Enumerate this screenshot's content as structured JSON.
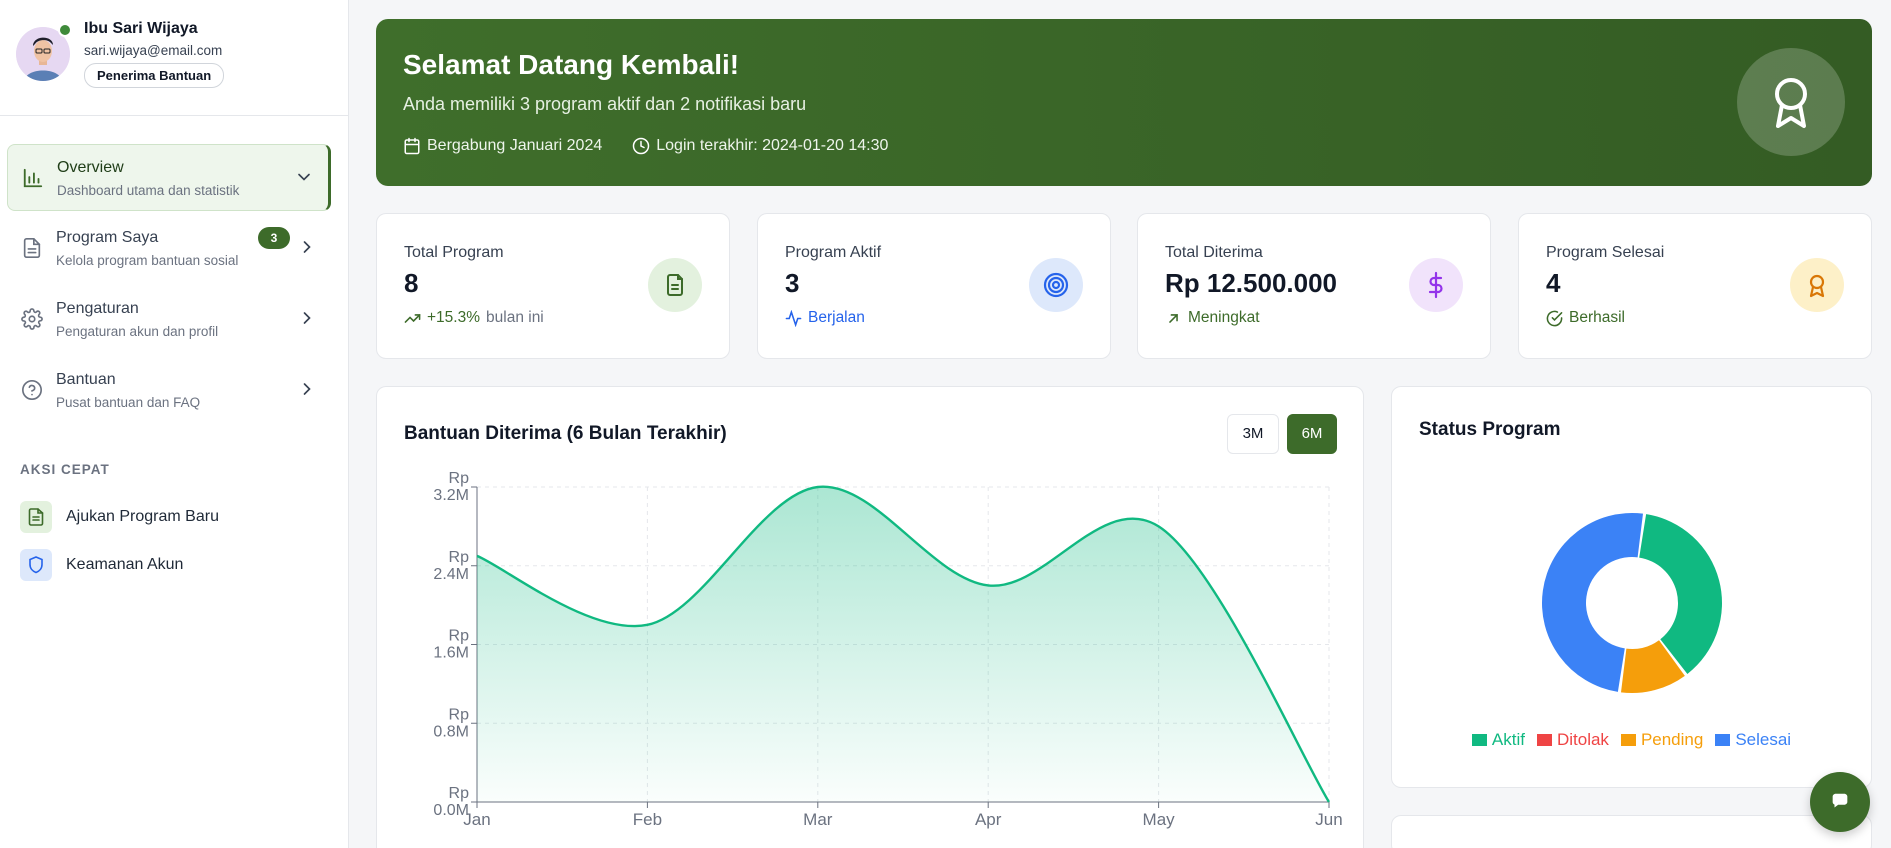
{
  "profile": {
    "name": "Ibu Sari Wijaya",
    "email": "sari.wijaya@email.com",
    "role": "Penerima Bantuan"
  },
  "nav": [
    {
      "label": "Overview",
      "sub": "Dashboard utama dan statistik",
      "icon": "bar-chart-icon",
      "active": true
    },
    {
      "label": "Program Saya",
      "sub": "Kelola program bantuan sosial",
      "icon": "document-icon",
      "badge": "3"
    },
    {
      "label": "Pengaturan",
      "sub": "Pengaturan akun dan profil",
      "icon": "gear-icon"
    },
    {
      "label": "Bantuan",
      "sub": "Pusat bantuan dan FAQ",
      "icon": "help-circle-icon"
    }
  ],
  "quick": {
    "title": "AKSI CEPAT",
    "items": [
      {
        "label": "Ajukan Program Baru",
        "icon": "document-icon"
      },
      {
        "label": "Keamanan Akun",
        "icon": "shield-icon"
      }
    ]
  },
  "hero": {
    "title": "Selamat Datang Kembali!",
    "subtitle": "Anda memiliki 3 program aktif dan 2 notifikasi baru",
    "joined": "Bergabung Januari 2024",
    "last_login": "Login terakhir: 2024-01-20 14:30"
  },
  "stats": [
    {
      "label": "Total Program",
      "value": "8",
      "foot": "+15.3%",
      "foot_suffix": "bulan ini",
      "foot_color": "#3d6b2a",
      "icon_bg": "#e3f1de"
    },
    {
      "label": "Program Aktif",
      "value": "3",
      "foot": "Berjalan",
      "foot_suffix": "",
      "foot_color": "#2563eb",
      "icon_bg": "#dde8fb"
    },
    {
      "label": "Total Diterima",
      "value": "Rp 12.500.000",
      "foot": "Meningkat",
      "foot_suffix": "",
      "foot_color": "#3d6b2a",
      "icon_bg": "#f1e3fb"
    },
    {
      "label": "Program Selesai",
      "value": "4",
      "foot": "Berhasil",
      "foot_suffix": "",
      "foot_color": "#3d6b2a",
      "icon_bg": "#fdf0c8"
    }
  ],
  "chart": {
    "title": "Bantuan Diterima (6 Bulan Terakhir)",
    "range_3m": "3M",
    "range_6m": "6M"
  },
  "status": {
    "title": "Status Program"
  },
  "colors": {
    "primary": "#3d6b2a",
    "aktif": "#10b981",
    "ditolak": "#ef4444",
    "pending": "#f59e0b",
    "selesai": "#3b82f6"
  },
  "chart_data": [
    {
      "type": "area",
      "title": "Bantuan Diterima (6 Bulan Terakhir)",
      "categories": [
        "Jan",
        "Feb",
        "Mar",
        "Apr",
        "May",
        "Jun"
      ],
      "values": [
        2500000,
        1800000,
        3200000,
        2200000,
        2800000,
        0
      ],
      "ytick_labels": [
        [
          "Rp",
          "0.0M"
        ],
        [
          "Rp",
          "0.8M"
        ],
        [
          "Rp",
          "1.6M"
        ],
        [
          "Rp",
          "2.4M"
        ],
        [
          "Rp",
          "3.2M"
        ]
      ],
      "yticks": [
        0,
        800000,
        1600000,
        2400000,
        3200000
      ],
      "ylim": [
        0,
        3200000
      ],
      "grid": true,
      "color": "#10b981"
    },
    {
      "type": "pie",
      "title": "Status Program",
      "categories": [
        "Aktif",
        "Ditolak",
        "Pending",
        "Selesai"
      ],
      "values": [
        3,
        0,
        1,
        4
      ],
      "colors": [
        "#10b981",
        "#ef4444",
        "#f59e0b",
        "#3b82f6"
      ],
      "legend": "bottom"
    }
  ]
}
